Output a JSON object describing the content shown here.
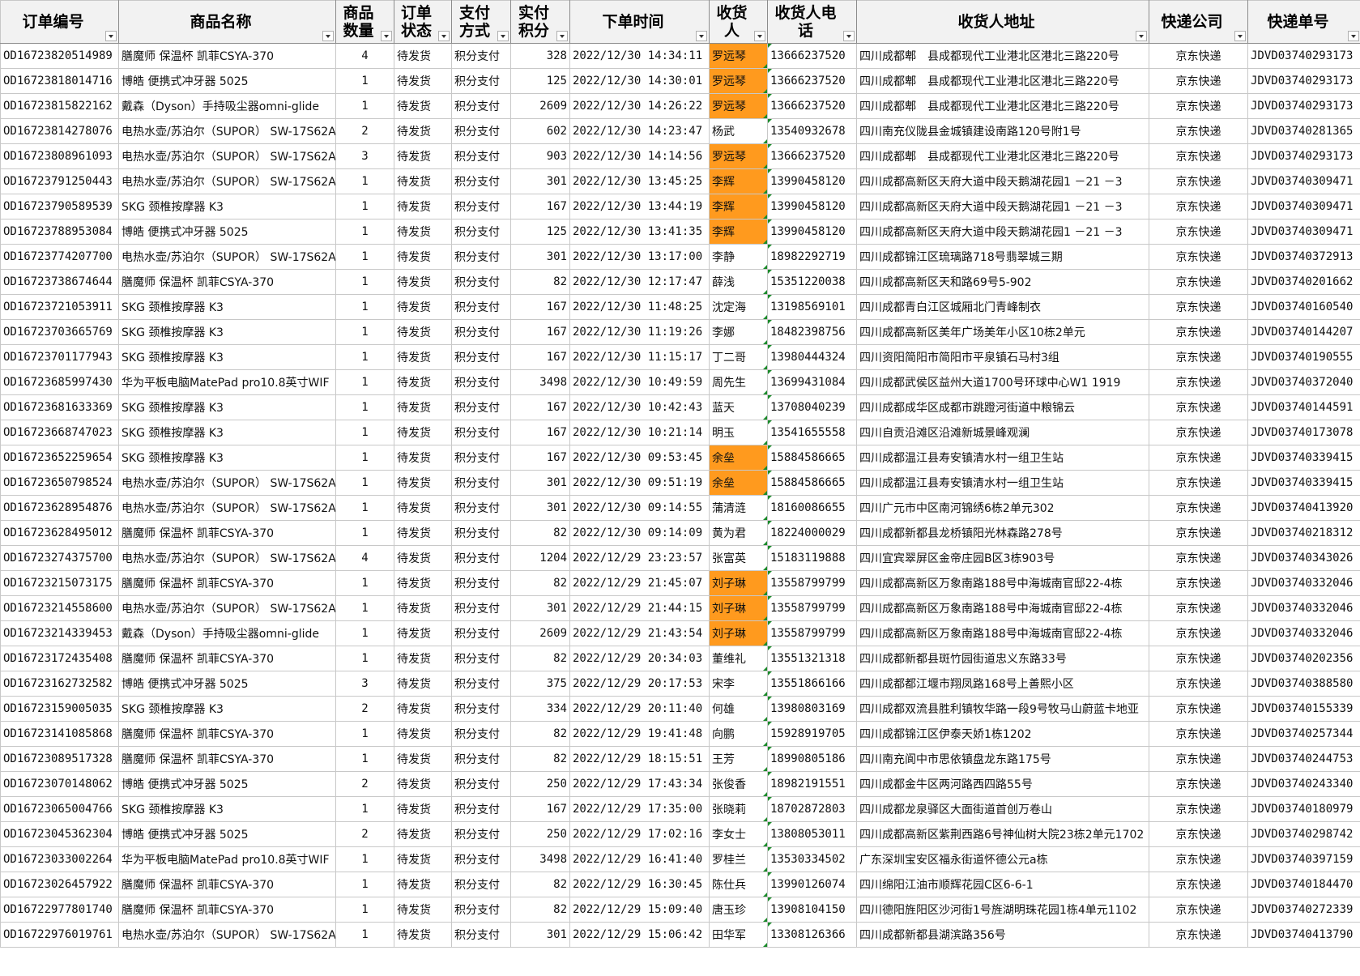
{
  "headers": [
    {
      "key": "order_no",
      "label": "订单编号"
    },
    {
      "key": "product",
      "label": "商品名称"
    },
    {
      "key": "qty",
      "label": "商品数量"
    },
    {
      "key": "status",
      "label": "订单状态"
    },
    {
      "key": "payment",
      "label": "支付方式"
    },
    {
      "key": "points",
      "label": "实付积分"
    },
    {
      "key": "order_time",
      "label": "下单时间"
    },
    {
      "key": "receiver",
      "label": "收货人"
    },
    {
      "key": "phone",
      "label": "收货人电话"
    },
    {
      "key": "address",
      "label": "收货人地址"
    },
    {
      "key": "courier",
      "label": "快递公司"
    },
    {
      "key": "tracking",
      "label": "快递单号"
    }
  ],
  "highlight_color": "#ff9a1e",
  "rows": [
    {
      "order_no": "OD16723820514989",
      "product": "膳魔师 保温杯 凯菲CSYA-370",
      "qty": "4",
      "status": "待发货",
      "payment": "积分支付",
      "points": "328",
      "order_time": "2022/12/30 14:34:11",
      "receiver": "罗远琴",
      "highlight": true,
      "phone": "13666237520",
      "address": "四川成都郫　县成都现代工业港北区港北三路220号",
      "courier": "京东快递",
      "tracking": "JDVD03740293173"
    },
    {
      "order_no": "OD16723818014716",
      "product": "博皓 便携式冲牙器 5025",
      "qty": "1",
      "status": "待发货",
      "payment": "积分支付",
      "points": "125",
      "order_time": "2022/12/30 14:30:01",
      "receiver": "罗远琴",
      "highlight": true,
      "phone": "13666237520",
      "address": "四川成都郫　县成都现代工业港北区港北三路220号",
      "courier": "京东快递",
      "tracking": "JDVD03740293173"
    },
    {
      "order_no": "OD16723815822162",
      "product": "戴森（Dyson）手持吸尘器omni-glide",
      "qty": "1",
      "status": "待发货",
      "payment": "积分支付",
      "points": "2609",
      "order_time": "2022/12/30 14:26:22",
      "receiver": "罗远琴",
      "highlight": true,
      "phone": "13666237520",
      "address": "四川成都郫　县成都现代工业港北区港北三路220号",
      "courier": "京东快递",
      "tracking": "JDVD03740293173"
    },
    {
      "order_no": "OD16723814278076",
      "product": "电热水壶/苏泊尔（SUPOR） SW-17S62A",
      "qty": "2",
      "status": "待发货",
      "payment": "积分支付",
      "points": "602",
      "order_time": "2022/12/30 14:23:47",
      "receiver": "杨武",
      "highlight": false,
      "phone": "13540932678",
      "address": "四川南充仪陇县金城镇建设南路120号附1号",
      "courier": "京东快递",
      "tracking": "JDVD03740281365"
    },
    {
      "order_no": "OD16723808961093",
      "product": "电热水壶/苏泊尔（SUPOR） SW-17S62A",
      "qty": "3",
      "status": "待发货",
      "payment": "积分支付",
      "points": "903",
      "order_time": "2022/12/30 14:14:56",
      "receiver": "罗远琴",
      "highlight": true,
      "phone": "13666237520",
      "address": "四川成都郫　县成都现代工业港北区港北三路220号",
      "courier": "京东快递",
      "tracking": "JDVD03740293173"
    },
    {
      "order_no": "OD16723791250443",
      "product": "电热水壶/苏泊尔（SUPOR） SW-17S62A",
      "qty": "1",
      "status": "待发货",
      "payment": "积分支付",
      "points": "301",
      "order_time": "2022/12/30 13:45:25",
      "receiver": "李辉",
      "highlight": true,
      "phone": "13990458120",
      "address": "四川成都高新区天府大道中段天鹅湖花园1 －21 －3",
      "courier": "京东快递",
      "tracking": "JDVD03740309471"
    },
    {
      "order_no": "OD16723790589539",
      "product": "SKG 颈椎按摩器 K3",
      "qty": "1",
      "status": "待发货",
      "payment": "积分支付",
      "points": "167",
      "order_time": "2022/12/30 13:44:19",
      "receiver": "李辉",
      "highlight": true,
      "phone": "13990458120",
      "address": "四川成都高新区天府大道中段天鹅湖花园1 －21 －3",
      "courier": "京东快递",
      "tracking": "JDVD03740309471"
    },
    {
      "order_no": "OD16723788953084",
      "product": "博皓 便携式冲牙器 5025",
      "qty": "1",
      "status": "待发货",
      "payment": "积分支付",
      "points": "125",
      "order_time": "2022/12/30 13:41:35",
      "receiver": "李辉",
      "highlight": true,
      "phone": "13990458120",
      "address": "四川成都高新区天府大道中段天鹅湖花园1 －21 －3",
      "courier": "京东快递",
      "tracking": "JDVD03740309471"
    },
    {
      "order_no": "OD16723774207700",
      "product": "电热水壶/苏泊尔（SUPOR） SW-17S62A",
      "qty": "1",
      "status": "待发货",
      "payment": "积分支付",
      "points": "301",
      "order_time": "2022/12/30 13:17:00",
      "receiver": "李静",
      "highlight": false,
      "phone": "18982292719",
      "address": "四川成都锦江区琉璃路718号翡翠城三期",
      "courier": "京东快递",
      "tracking": "JDVD03740372913"
    },
    {
      "order_no": "OD16723738674644",
      "product": "膳魔师 保温杯 凯菲CSYA-370",
      "qty": "1",
      "status": "待发货",
      "payment": "积分支付",
      "points": "82",
      "order_time": "2022/12/30 12:17:47",
      "receiver": "薛浅",
      "highlight": false,
      "phone": "15351220038",
      "address": "四川成都高新区天和路69号5-902",
      "courier": "京东快递",
      "tracking": "JDVD03740201662"
    },
    {
      "order_no": "OD16723721053911",
      "product": "SKG 颈椎按摩器 K3",
      "qty": "1",
      "status": "待发货",
      "payment": "积分支付",
      "points": "167",
      "order_time": "2022/12/30 11:48:25",
      "receiver": "沈定海",
      "highlight": false,
      "phone": "13198569101",
      "address": "四川成都青白江区城厢北门青峰制衣",
      "courier": "京东快递",
      "tracking": "JDVD03740160540"
    },
    {
      "order_no": "OD16723703665769",
      "product": "SKG 颈椎按摩器 K3",
      "qty": "1",
      "status": "待发货",
      "payment": "积分支付",
      "points": "167",
      "order_time": "2022/12/30 11:19:26",
      "receiver": "李娜",
      "highlight": false,
      "phone": "18482398756",
      "address": "四川成都高新区美年广场美年小区10栋2单元",
      "courier": "京东快递",
      "tracking": "JDVD03740144207"
    },
    {
      "order_no": "OD16723701177943",
      "product": "SKG 颈椎按摩器 K3",
      "qty": "1",
      "status": "待发货",
      "payment": "积分支付",
      "points": "167",
      "order_time": "2022/12/30 11:15:17",
      "receiver": "丁二哥",
      "highlight": false,
      "phone": "13980444324",
      "address": "四川资阳简阳市简阳市平泉镇石马村3组",
      "courier": "京东快递",
      "tracking": "JDVD03740190555"
    },
    {
      "order_no": "OD16723685997430",
      "product": "华为平板电脑MatePad pro10.8英寸WIF",
      "qty": "1",
      "status": "待发货",
      "payment": "积分支付",
      "points": "3498",
      "order_time": "2022/12/30 10:49:59",
      "receiver": "周先生",
      "highlight": false,
      "phone": "13699431084",
      "address": "四川成都武侯区益州大道1700号环球中心W1 1919",
      "courier": "京东快递",
      "tracking": "JDVD03740372040"
    },
    {
      "order_no": "OD16723681633369",
      "product": "SKG 颈椎按摩器 K3",
      "qty": "1",
      "status": "待发货",
      "payment": "积分支付",
      "points": "167",
      "order_time": "2022/12/30 10:42:43",
      "receiver": "蓝天",
      "highlight": false,
      "phone": "13708040239",
      "address": "四川成都成华区成都市跳蹬河街道中粮锦云",
      "courier": "京东快递",
      "tracking": "JDVD03740144591"
    },
    {
      "order_no": "OD16723668747023",
      "product": "SKG 颈椎按摩器 K3",
      "qty": "1",
      "status": "待发货",
      "payment": "积分支付",
      "points": "167",
      "order_time": "2022/12/30 10:21:14",
      "receiver": "明玉",
      "highlight": false,
      "phone": "13541655558",
      "address": "四川自贡沿滩区沿滩新城景峰观澜",
      "courier": "京东快递",
      "tracking": "JDVD03740173078"
    },
    {
      "order_no": "OD16723652259654",
      "product": "SKG 颈椎按摩器 K3",
      "qty": "1",
      "status": "待发货",
      "payment": "积分支付",
      "points": "167",
      "order_time": "2022/12/30 09:53:45",
      "receiver": "余垒",
      "highlight": true,
      "phone": "15884586665",
      "address": "四川成都温江县寿安镇清水村一组卫生站",
      "courier": "京东快递",
      "tracking": "JDVD03740339415"
    },
    {
      "order_no": "OD16723650798524",
      "product": "电热水壶/苏泊尔（SUPOR） SW-17S62A",
      "qty": "1",
      "status": "待发货",
      "payment": "积分支付",
      "points": "301",
      "order_time": "2022/12/30 09:51:19",
      "receiver": "余垒",
      "highlight": true,
      "phone": "15884586665",
      "address": "四川成都温江县寿安镇清水村一组卫生站",
      "courier": "京东快递",
      "tracking": "JDVD03740339415"
    },
    {
      "order_no": "OD16723628954876",
      "product": "电热水壶/苏泊尔（SUPOR） SW-17S62A",
      "qty": "1",
      "status": "待发货",
      "payment": "积分支付",
      "points": "301",
      "order_time": "2022/12/30 09:14:55",
      "receiver": "蒲清涟",
      "highlight": false,
      "phone": "18160086655",
      "address": "四川广元市中区南河锦绣6栋2单元302",
      "courier": "京东快递",
      "tracking": "JDVD03740413920"
    },
    {
      "order_no": "OD16723628495012",
      "product": "膳魔师 保温杯 凯菲CSYA-370",
      "qty": "1",
      "status": "待发货",
      "payment": "积分支付",
      "points": "82",
      "order_time": "2022/12/30 09:14:09",
      "receiver": "黄为君",
      "highlight": false,
      "phone": "18224000029",
      "address": "四川成都新都县龙桥镇阳光林森路278号",
      "courier": "京东快递",
      "tracking": "JDVD03740218312"
    },
    {
      "order_no": "OD16723274375700",
      "product": "电热水壶/苏泊尔（SUPOR） SW-17S62A",
      "qty": "4",
      "status": "待发货",
      "payment": "积分支付",
      "points": "1204",
      "order_time": "2022/12/29 23:23:57",
      "receiver": "张富英",
      "highlight": false,
      "phone": "15183119888",
      "address": "四川宜宾翠屏区金帝庄园B区3栋903号",
      "courier": "京东快递",
      "tracking": "JDVD03740343026"
    },
    {
      "order_no": "OD16723215073175",
      "product": "膳魔师 保温杯 凯菲CSYA-370",
      "qty": "1",
      "status": "待发货",
      "payment": "积分支付",
      "points": "82",
      "order_time": "2022/12/29 21:45:07",
      "receiver": "刘子琳",
      "highlight": true,
      "phone": "13558799799",
      "address": "四川成都高新区万象南路188号中海城南官邸22-4栋",
      "courier": "京东快递",
      "tracking": "JDVD03740332046"
    },
    {
      "order_no": "OD16723214558600",
      "product": "电热水壶/苏泊尔（SUPOR） SW-17S62A",
      "qty": "1",
      "status": "待发货",
      "payment": "积分支付",
      "points": "301",
      "order_time": "2022/12/29 21:44:15",
      "receiver": "刘子琳",
      "highlight": true,
      "phone": "13558799799",
      "address": "四川成都高新区万象南路188号中海城南官邸22-4栋",
      "courier": "京东快递",
      "tracking": "JDVD03740332046"
    },
    {
      "order_no": "OD16723214339453",
      "product": "戴森（Dyson）手持吸尘器omni-glide",
      "qty": "1",
      "status": "待发货",
      "payment": "积分支付",
      "points": "2609",
      "order_time": "2022/12/29 21:43:54",
      "receiver": "刘子琳",
      "highlight": true,
      "phone": "13558799799",
      "address": "四川成都高新区万象南路188号中海城南官邸22-4栋",
      "courier": "京东快递",
      "tracking": "JDVD03740332046"
    },
    {
      "order_no": "OD16723172435408",
      "product": "膳魔师 保温杯 凯菲CSYA-370",
      "qty": "1",
      "status": "待发货",
      "payment": "积分支付",
      "points": "82",
      "order_time": "2022/12/29 20:34:03",
      "receiver": "董维礼",
      "highlight": false,
      "phone": "13551321318",
      "address": "四川成都新都县斑竹园街道忠义东路33号",
      "courier": "京东快递",
      "tracking": "JDVD03740202356"
    },
    {
      "order_no": "OD16723162732582",
      "product": "博皓 便携式冲牙器 5025",
      "qty": "3",
      "status": "待发货",
      "payment": "积分支付",
      "points": "375",
      "order_time": "2022/12/29 20:17:53",
      "receiver": "宋李",
      "highlight": false,
      "phone": "13551866166",
      "address": "四川成都都江堰市翔凤路168号上善熙小区",
      "courier": "京东快递",
      "tracking": "JDVD03740388580"
    },
    {
      "order_no": "OD16723159005035",
      "product": "SKG 颈椎按摩器 K3",
      "qty": "2",
      "status": "待发货",
      "payment": "积分支付",
      "points": "334",
      "order_time": "2022/12/29 20:11:40",
      "receiver": "何雄",
      "highlight": false,
      "phone": "13980803169",
      "address": "四川成都双流县胜利镇牧华路一段9号牧马山蔚蓝卡地亚",
      "courier": "京东快递",
      "tracking": "JDVD03740155339"
    },
    {
      "order_no": "OD16723141085868",
      "product": "膳魔师 保温杯 凯菲CSYA-370",
      "qty": "1",
      "status": "待发货",
      "payment": "积分支付",
      "points": "82",
      "order_time": "2022/12/29 19:41:48",
      "receiver": "向鹏",
      "highlight": false,
      "phone": "15928919705",
      "address": "四川成都锦江区伊泰天娇1栋1202",
      "courier": "京东快递",
      "tracking": "JDVD03740257344"
    },
    {
      "order_no": "OD16723089517328",
      "product": "膳魔师 保温杯 凯菲CSYA-370",
      "qty": "1",
      "status": "待发货",
      "payment": "积分支付",
      "points": "82",
      "order_time": "2022/12/29 18:15:51",
      "receiver": "王芳",
      "highlight": false,
      "phone": "18990805186",
      "address": "四川南充阆中市思依镇盘龙东路175号",
      "courier": "京东快递",
      "tracking": "JDVD03740244753"
    },
    {
      "order_no": "OD16723070148062",
      "product": "博皓 便携式冲牙器 5025",
      "qty": "2",
      "status": "待发货",
      "payment": "积分支付",
      "points": "250",
      "order_time": "2022/12/29 17:43:34",
      "receiver": "张俊香",
      "highlight": false,
      "phone": "18982191551",
      "address": "四川成都金牛区两河路西四路55号",
      "courier": "京东快递",
      "tracking": "JDVD03740243340"
    },
    {
      "order_no": "OD16723065004766",
      "product": "SKG 颈椎按摩器 K3",
      "qty": "1",
      "status": "待发货",
      "payment": "积分支付",
      "points": "167",
      "order_time": "2022/12/29 17:35:00",
      "receiver": "张晓莉",
      "highlight": false,
      "phone": "18702872803",
      "address": "四川成都龙泉驿区大面街道首创万卷山",
      "courier": "京东快递",
      "tracking": "JDVD03740180979"
    },
    {
      "order_no": "OD16723045362304",
      "product": "博皓 便携式冲牙器 5025",
      "qty": "2",
      "status": "待发货",
      "payment": "积分支付",
      "points": "250",
      "order_time": "2022/12/29 17:02:16",
      "receiver": "李女士",
      "highlight": false,
      "phone": "13808053011",
      "address": "四川成都高新区紫荆西路6号神仙树大院23栋2单元1702",
      "courier": "京东快递",
      "tracking": "JDVD03740298742"
    },
    {
      "order_no": "OD16723033002264",
      "product": "华为平板电脑MatePad pro10.8英寸WIF",
      "qty": "1",
      "status": "待发货",
      "payment": "积分支付",
      "points": "3498",
      "order_time": "2022/12/29 16:41:40",
      "receiver": "罗桂兰",
      "highlight": false,
      "phone": "13530334502",
      "address": "广东深圳宝安区福永街道怀德公元a栋",
      "courier": "京东快递",
      "tracking": "JDVD03740397159"
    },
    {
      "order_no": "OD16723026457922",
      "product": "膳魔师 保温杯 凯菲CSYA-370",
      "qty": "1",
      "status": "待发货",
      "payment": "积分支付",
      "points": "82",
      "order_time": "2022/12/29 16:30:45",
      "receiver": "陈仕兵",
      "highlight": false,
      "phone": "13990126074",
      "address": "四川绵阳江油市顺辉花园C区6-6-1",
      "courier": "京东快递",
      "tracking": "JDVD03740184470"
    },
    {
      "order_no": "OD16722977801740",
      "product": "膳魔师 保温杯 凯菲CSYA-370",
      "qty": "1",
      "status": "待发货",
      "payment": "积分支付",
      "points": "82",
      "order_time": "2022/12/29 15:09:40",
      "receiver": "唐玉珍",
      "highlight": false,
      "phone": "13908104150",
      "address": "四川德阳旌阳区沙河街1号旌湖明珠花园1栋4单元1102",
      "courier": "京东快递",
      "tracking": "JDVD03740272339"
    },
    {
      "order_no": "OD16722976019761",
      "product": "电热水壶/苏泊尔（SUPOR） SW-17S62A",
      "qty": "1",
      "status": "待发货",
      "payment": "积分支付",
      "points": "301",
      "order_time": "2022/12/29 15:06:42",
      "receiver": "田华军",
      "highlight": false,
      "phone": "13308126366",
      "address": "四川成都新都县湖滨路356号",
      "courier": "京东快递",
      "tracking": "JDVD03740413790"
    }
  ]
}
